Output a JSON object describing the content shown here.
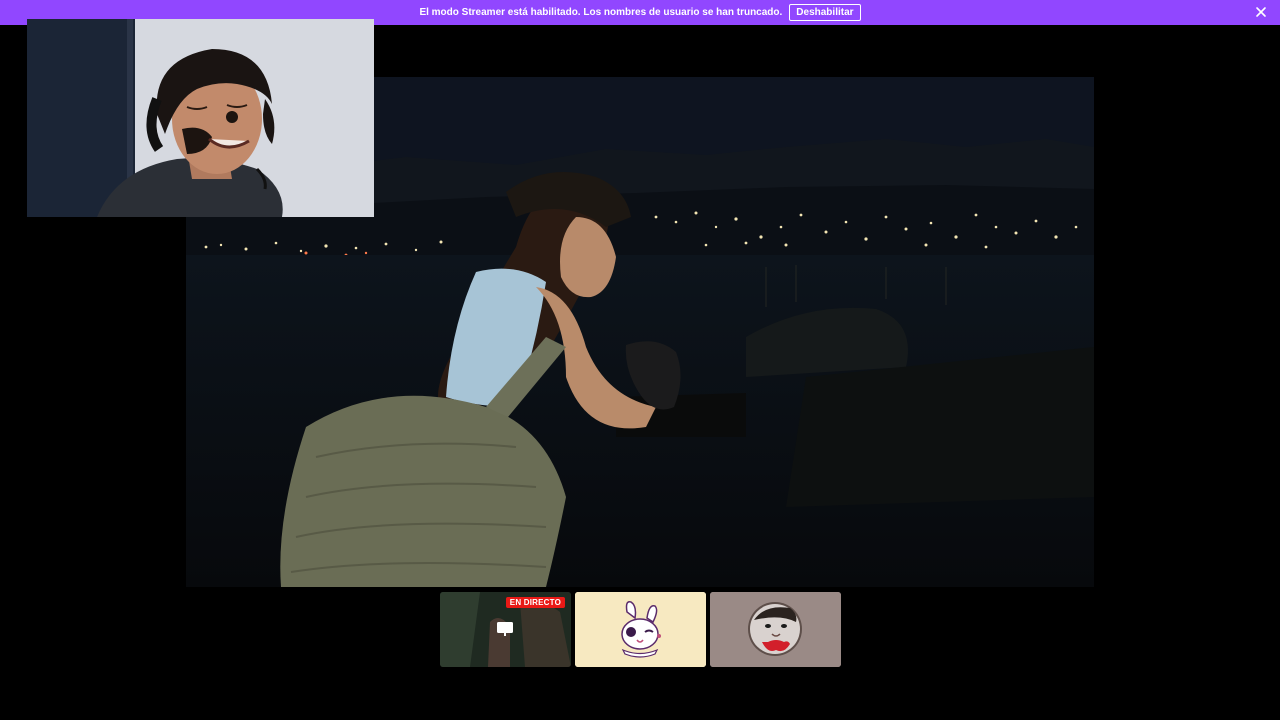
{
  "banner": {
    "message": "El modo Streamer está habilitado. Los nombres de usuario se han truncado.",
    "disable_label": "Deshabilitar",
    "close_icon": "close-icon",
    "background_color": "#9147ff"
  },
  "main_video": {
    "scene": "night-coast-city-lights"
  },
  "facecam": {
    "scene": "streamer-webcam"
  },
  "thumbnails": [
    {
      "badge": "EN DIRECTO",
      "icon": "screen-share-icon"
    },
    {
      "icon": "bunny-avatar"
    },
    {
      "icon": "cat-avatar"
    }
  ],
  "colors": {
    "accent": "#9147ff",
    "live": "#e91916"
  }
}
